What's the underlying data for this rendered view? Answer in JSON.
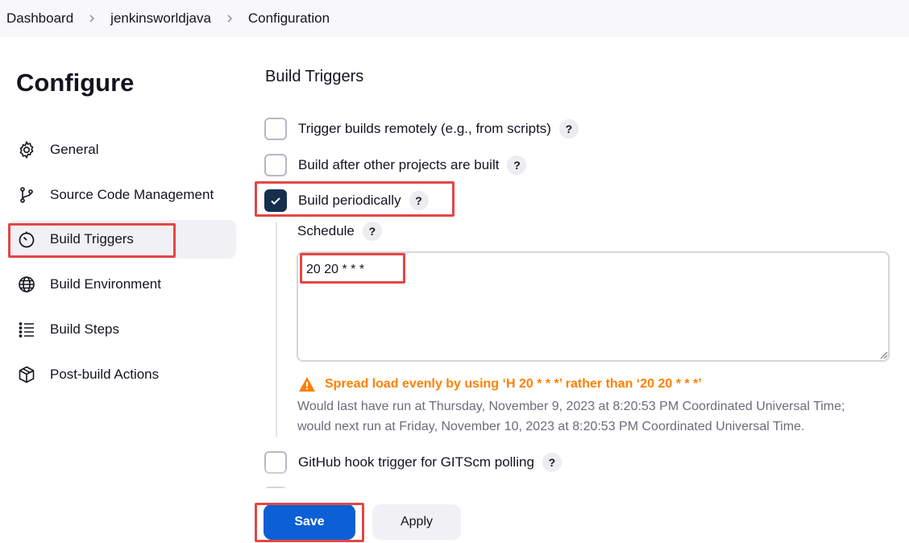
{
  "breadcrumb": {
    "items": [
      "Dashboard",
      "jenkinsworldjava",
      "Configuration"
    ]
  },
  "sidebar": {
    "title": "Configure",
    "items": [
      {
        "label": "General",
        "icon": "gear-icon"
      },
      {
        "label": "Source Code Management",
        "icon": "branch-icon"
      },
      {
        "label": "Build Triggers",
        "icon": "timer-icon",
        "active": true
      },
      {
        "label": "Build Environment",
        "icon": "globe-icon"
      },
      {
        "label": "Build Steps",
        "icon": "list-icon"
      },
      {
        "label": "Post-build Actions",
        "icon": "package-icon"
      }
    ]
  },
  "main": {
    "section_title": "Build Triggers",
    "triggers": [
      {
        "label": "Trigger builds remotely (e.g., from scripts)",
        "checked": false,
        "help": "?"
      },
      {
        "label": "Build after other projects are built",
        "checked": false,
        "help": "?"
      },
      {
        "label": "Build periodically",
        "checked": true,
        "help": "?"
      },
      {
        "label": "GitHub hook trigger for GITScm polling",
        "checked": false,
        "help": "?"
      }
    ],
    "schedule": {
      "label": "Schedule",
      "help": "?",
      "value": "20 20 * * *"
    },
    "warning": "Spread load evenly by using ‘H 20 * * *’ rather than ‘20 20 * * *’",
    "info_line_1": "Would last have run at Thursday, November 9, 2023 at 8:20:53 PM Coordinated Universal Time;",
    "info_line_2": "would next run at Friday, November 10, 2023 at 8:20:53 PM Coordinated Universal Time."
  },
  "footer": {
    "save_label": "Save",
    "apply_label": "Apply"
  },
  "colors": {
    "primary": "#0c5fd4",
    "checkbox_checked": "#14304c",
    "warning": "#fe8001",
    "highlight": "#e54545"
  }
}
